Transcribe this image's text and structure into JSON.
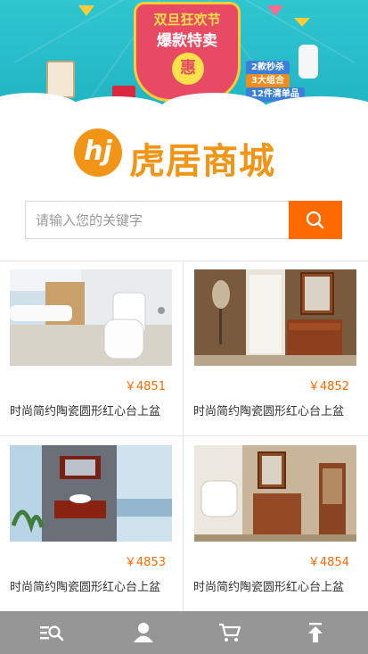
{
  "banner": {
    "headline_top": "双旦狂欢节",
    "headline_main": "爆款特卖",
    "hui": "惠",
    "tags": [
      "2款秒杀",
      "3大组合",
      "12件清单品"
    ]
  },
  "brand": {
    "logo_mark": "hj",
    "name": "虎居商城",
    "accent_color": "#f29516"
  },
  "search": {
    "placeholder": "请输入您的关键字",
    "value": "",
    "button_icon": "search-icon",
    "button_color": "#ff6a00"
  },
  "products": [
    {
      "price": "￥4851",
      "title": "时尚简约陶瓷圆形红心台上盆",
      "image": "white toilet in bathroom"
    },
    {
      "price": "￥4852",
      "title": "时尚简约陶瓷圆形红心台上盆",
      "image": "wooden bathroom vanity with mirror"
    },
    {
      "price": "￥4853",
      "title": "时尚简约陶瓷圆形红心台上盆",
      "image": "wall-mounted red wood vanity"
    },
    {
      "price": "￥4854",
      "title": "时尚简约陶瓷圆形红心台上盆",
      "image": "classic wooden vanity and cabinet"
    }
  ],
  "bottom_nav": [
    {
      "icon": "category-search-icon"
    },
    {
      "icon": "user-icon"
    },
    {
      "icon": "cart-icon"
    },
    {
      "icon": "back-to-top-icon"
    }
  ]
}
